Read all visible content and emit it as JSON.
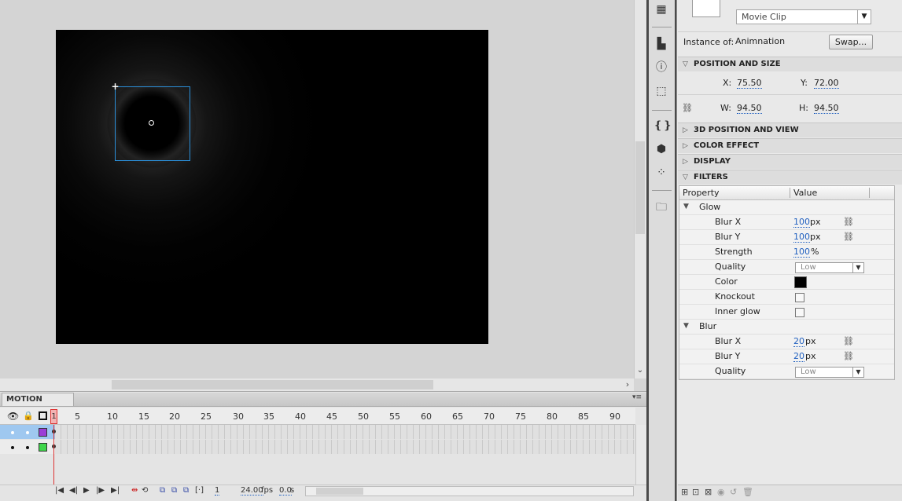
{
  "properties": {
    "symbol_type": "Movie Clip",
    "instance_of_label": "Instance of:",
    "instance_name": "Animnation",
    "swap_label": "Swap...",
    "sections": {
      "position_size": "POSITION AND SIZE",
      "position_3d": "3D POSITION AND VIEW",
      "color_effect": "COLOR EFFECT",
      "display": "DISPLAY",
      "filters": "FILTERS"
    },
    "position": {
      "x_label": "X:",
      "x": "75.50",
      "y_label": "Y:",
      "y": "72.00"
    },
    "size": {
      "w_label": "W:",
      "w": "94.50",
      "h_label": "H:",
      "h": "94.50"
    }
  },
  "filters": {
    "col_property": "Property",
    "col_value": "Value",
    "glow": {
      "name": "Glow",
      "blur_x_label": "Blur X",
      "blur_x": "100",
      "blur_x_unit": "px",
      "blur_y_label": "Blur Y",
      "blur_y": "100",
      "blur_y_unit": "px",
      "strength_label": "Strength",
      "strength": "100",
      "strength_unit": "%",
      "quality_label": "Quality",
      "quality": "Low",
      "color_label": "Color",
      "color": "#000000",
      "knockout_label": "Knockout",
      "inner_glow_label": "Inner glow"
    },
    "blur": {
      "name": "Blur",
      "blur_x_label": "Blur X",
      "blur_x": "20",
      "blur_x_unit": "px",
      "blur_y_label": "Blur Y",
      "blur_y": "20",
      "blur_y_unit": "px",
      "quality_label": "Quality",
      "quality": "Low"
    }
  },
  "timeline": {
    "tab_label": "MOTION EDITOR",
    "ruler_labels": [
      "5",
      "10",
      "15",
      "20",
      "25",
      "30",
      "35",
      "40",
      "45",
      "50",
      "55",
      "60",
      "65",
      "70",
      "75",
      "80",
      "85",
      "90"
    ],
    "playhead_frame": "1",
    "current_frame": "1",
    "fps": "24.00",
    "fps_unit": "fps",
    "elapsed": "0.0",
    "elapsed_unit": "s",
    "layer_colors": [
      "#9b3fd6",
      "#3fd64a"
    ]
  },
  "colors": {
    "selection": "#2b8fd9",
    "link_value": "#1f5fbf",
    "playhead": "#dd3333"
  }
}
